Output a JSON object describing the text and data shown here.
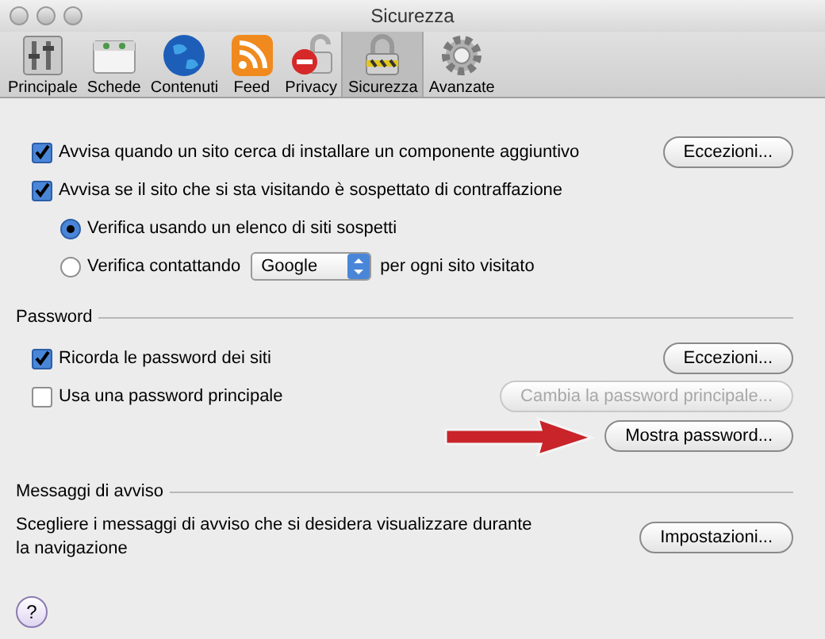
{
  "window": {
    "title": "Sicurezza"
  },
  "toolbar": [
    {
      "label": "Principale",
      "selected": false
    },
    {
      "label": "Schede",
      "selected": false
    },
    {
      "label": "Contenuti",
      "selected": false
    },
    {
      "label": "Feed",
      "selected": false
    },
    {
      "label": "Privacy",
      "selected": false
    },
    {
      "label": "Sicurezza",
      "selected": true
    },
    {
      "label": "Avanzate",
      "selected": false
    }
  ],
  "general": {
    "options": [
      {
        "kind": "checkbox",
        "label": "Avvisa quando un sito cerca di installare un componente aggiuntivo",
        "checked": true,
        "button": {
          "label": "Eccezioni...",
          "disabled": false
        }
      },
      {
        "kind": "checkbox",
        "label": "Avvisa se il sito che si sta visitando è sospettato di contraffazione",
        "checked": true
      },
      {
        "kind": "radio",
        "label": "Verifica usando un elenco di siti sospetti",
        "selected": true
      },
      {
        "kind": "radio",
        "label": "Verifica contattando",
        "selected": false,
        "dropdown": "Google",
        "suffix": "per ogni sito visitato"
      }
    ]
  },
  "password": {
    "heading": "Password",
    "options": [
      {
        "kind": "checkbox",
        "label": "Ricorda le password dei siti",
        "checked": true,
        "button": {
          "label": "Eccezioni...",
          "disabled": false
        }
      },
      {
        "kind": "checkbox",
        "label": "Usa una password principale",
        "checked": false,
        "button": {
          "label": "Cambia la password principale...",
          "disabled": true
        }
      }
    ],
    "show_button": {
      "label": "Mostra password...",
      "disabled": false
    }
  },
  "warnings": {
    "heading": "Messaggi di avviso",
    "text": "Scegliere i messaggi di avviso che si desidera visualizzare durante la navigazione",
    "button": {
      "label": "Impostazioni...",
      "disabled": false
    }
  },
  "help_button": "?"
}
